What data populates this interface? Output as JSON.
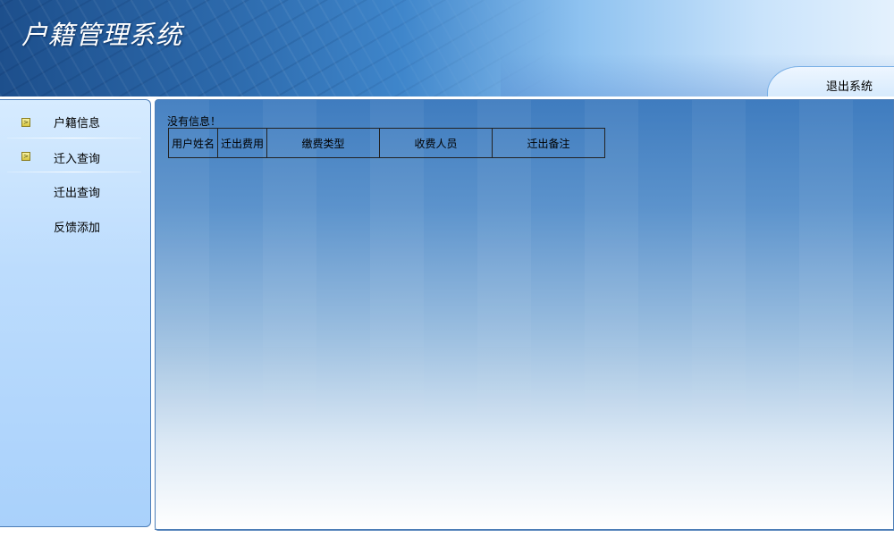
{
  "header": {
    "app_title": "户籍管理系统",
    "logout_label": "退出系统"
  },
  "sidebar": {
    "items": [
      {
        "label": "户籍信息",
        "has_bullet": true
      },
      {
        "label": "迁入查询",
        "has_bullet": true
      },
      {
        "label": "迁出查询",
        "has_bullet": false
      },
      {
        "label": "反馈添加",
        "has_bullet": false
      }
    ]
  },
  "main": {
    "empty_message": "没有信息！",
    "table": {
      "columns": [
        "用户姓名",
        "迁出费用",
        "缴费类型",
        "收费人员",
        "迁出备注"
      ],
      "rows": []
    }
  },
  "colors": {
    "header_dark": "#1d4f8c",
    "header_light": "#e4f1fd",
    "sidebar_bg": "#bcdcfd",
    "main_top": "#3f7cbf",
    "border": "#4c7db7"
  },
  "icons": {
    "menu_bullet": "arrow-right-icon"
  }
}
